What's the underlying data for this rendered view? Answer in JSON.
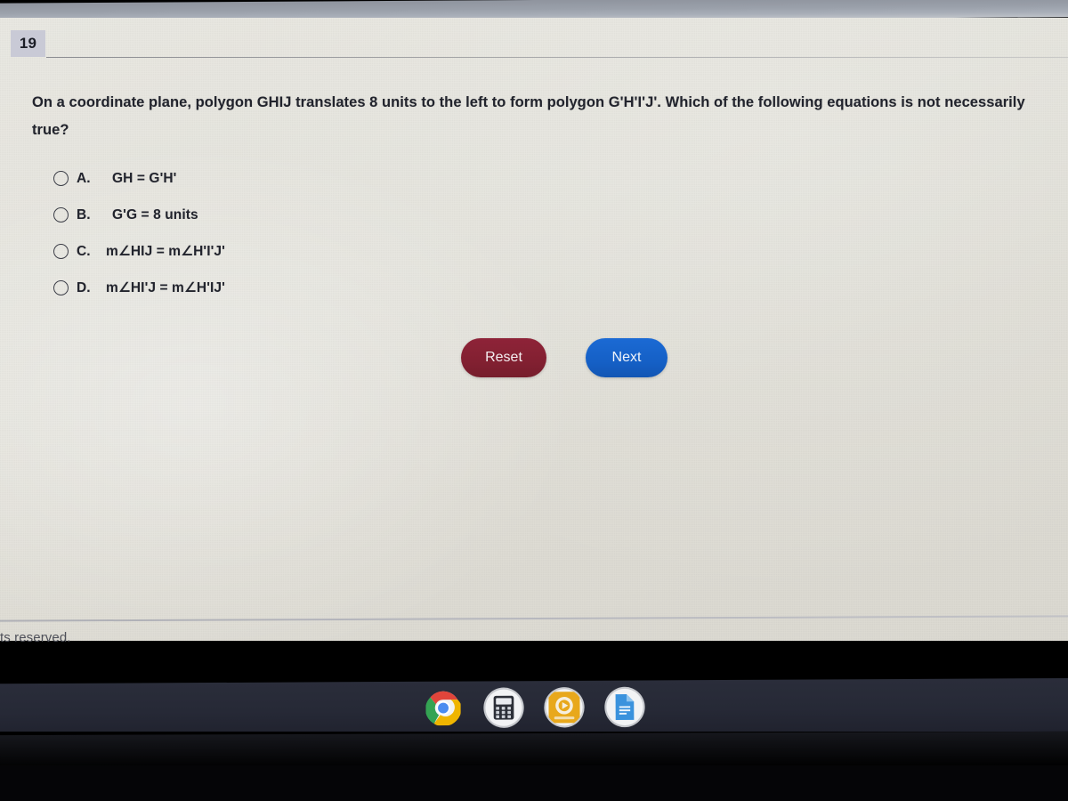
{
  "quiz": {
    "question_number": "19",
    "stem": "On a coordinate plane, polygon GHIJ translates 8 units to the left to form polygon G'H'I'J'. Which of the following equations is not necessarily true?",
    "options": [
      {
        "letter": "A.",
        "text": "GH = G'H'"
      },
      {
        "letter": "B.",
        "text": "G'G = 8 units"
      },
      {
        "letter": "C.",
        "text": "m∠HIJ = m∠H'I'J'"
      },
      {
        "letter": "D.",
        "text": "m∠HI'J = m∠H'IJ'"
      }
    ],
    "buttons": {
      "reset": "Reset",
      "next": "Next"
    },
    "footer": "ts reserved."
  },
  "colors": {
    "reset_button": "#822031",
    "next_button": "#1560c6",
    "badge_background": "#c9cad6",
    "page_background": "#e4e3dc",
    "shelf_background": "#262936",
    "text": "#22242d"
  },
  "shelf": {
    "icons": [
      {
        "name": "chrome-icon",
        "label": "Chrome"
      },
      {
        "name": "calculator-icon",
        "label": "Calculator"
      },
      {
        "name": "orange-app-icon",
        "label": "App"
      },
      {
        "name": "docs-icon",
        "label": "Docs"
      }
    ]
  }
}
